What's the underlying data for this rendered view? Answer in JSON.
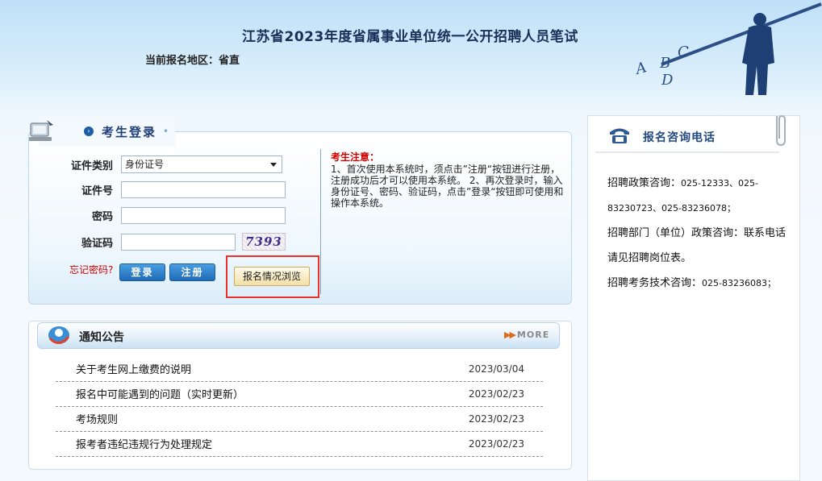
{
  "header": {
    "title": "江苏省2023年度省属事业单位统一公开招聘人员笔试",
    "region_label": "当前报名地区：省直"
  },
  "login": {
    "heading": "考生登录",
    "id_type_label": "证件类别",
    "id_type_value": "身份证号",
    "id_number_label": "证件号",
    "password_label": "密码",
    "captcha_label": "验证码",
    "captcha_text": "7393",
    "forgot_label": "忘记密码?",
    "login_button": "登录",
    "register_button": "注册",
    "browse_button": "报名情况浏览",
    "notice_title": "考生注意：",
    "notice_text": "1、首次使用本系统时，须点击”注册“按钮进行注册，注册成功后才可以使用本系统。 2、再次登录时，输入身份证号、密码、验证码，点击”登录“按钮即可使用和操作本系统。"
  },
  "announcements": {
    "heading": "通知公告",
    "more_label": "MORE",
    "items": [
      {
        "title": "关于考生网上缴费的说明",
        "date": "2023/03/04"
      },
      {
        "title": "报名中可能遇到的问题（实时更新）",
        "date": "2023/02/23"
      },
      {
        "title": "考场规则",
        "date": "2023/02/23"
      },
      {
        "title": "报考者违纪违规行为处理规定",
        "date": "2023/02/23"
      }
    ]
  },
  "contact": {
    "heading": "报名咨询电话",
    "policy_label": "招聘政策咨询：",
    "policy_numbers": "025-12333、025-83230723、025-83236078；",
    "dept_text": "招聘部门（单位）政策咨询：联系电话请见招聘岗位表。",
    "tech_label": "招聘考务技术咨询：",
    "tech_number": "025-83236083；"
  },
  "colors": {
    "accent": "#1f3f77",
    "alert": "#cc0000",
    "highlight_box": "#e8312b"
  }
}
